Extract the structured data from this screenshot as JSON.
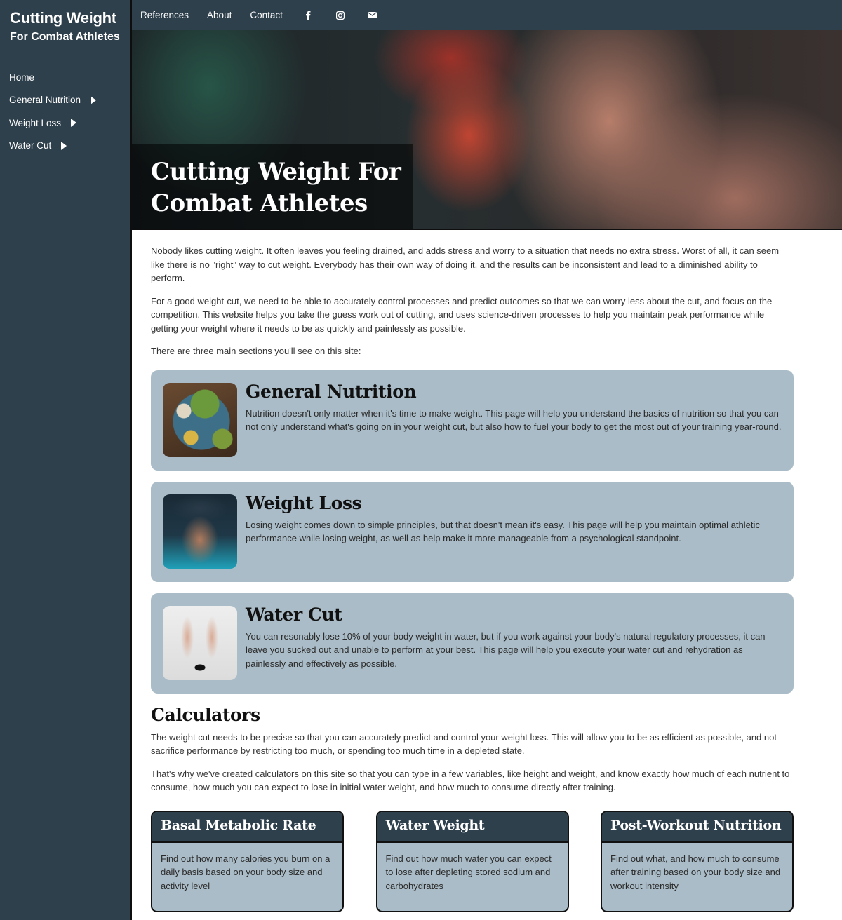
{
  "sidebar": {
    "brand_title": "Cutting Weight",
    "brand_subtitle": "For Combat Athletes",
    "items": [
      {
        "label": "Home",
        "has_submenu": false
      },
      {
        "label": "General Nutrition",
        "has_submenu": true
      },
      {
        "label": "Weight Loss",
        "has_submenu": true
      },
      {
        "label": "Water Cut",
        "has_submenu": true
      }
    ]
  },
  "topbar": {
    "links": [
      "References",
      "About",
      "Contact"
    ],
    "icons": [
      "facebook-icon",
      "instagram-icon",
      "mail-icon"
    ]
  },
  "hero": {
    "title_line1": "Cutting Weight For",
    "title_line2": "Combat Athletes"
  },
  "intro": {
    "p1": "Nobody likes cutting weight. It often leaves you feeling drained, and adds stress and worry to a situation that needs no extra stress. Worst of all, it can seem like there is no \"right\" way to cut weight. Everybody has their own way of doing it, and the results can be inconsistent and lead to a diminished ability to perform.",
    "p2": "For a good weight-cut, we need to be able to accurately control processes and predict outcomes so that we can worry less about the cut, and focus on the competition. This website helps you take the guess work out of cutting, and uses science-driven processes to help you maintain peak performance while getting your weight where it needs to be as quickly and painlessly as possible.",
    "p3": "There are three main sections you'll see on this site:"
  },
  "sections": [
    {
      "title": "General Nutrition",
      "text": "Nutrition doesn't only matter when it's time to make weight. This page will help you understand the basics of nutrition so that you can not only understand what's going on in your weight cut, but also how to fuel your body to get the most out of your training year-round."
    },
    {
      "title": "Weight Loss",
      "text": "Losing weight comes down to simple principles, but that doesn't mean it's easy. This page will help you maintain optimal athletic performance while losing weight, as well as help make it more manageable from a psychological standpoint."
    },
    {
      "title": "Water Cut",
      "text": "You can resonably lose 10% of your body weight in water, but if you work against your body's natural regulatory processes, it can leave you sucked out and unable to perform at your best. This page will help you execute your water cut and rehydration as painlessly and effectively as possible."
    }
  ],
  "calculators": {
    "heading": "Calculators",
    "p1": "The weight cut needs to be precise so that you can accurately predict and control your weight loss. This will allow you to be as efficient as possible, and not sacrifice performance by restricting too much, or spending too much time in a depleted state.",
    "p2": "That's why we've created calculators on this site so that you can type in a few variables, like height and weight, and know exactly how much of each nutrient to consume, how much you can expect to lose in initial water weight, and how much to consume directly after training.",
    "cards": [
      {
        "title": "Basal Metabolic Rate",
        "text": "Find out how many calories you burn on a daily basis based on your body size and activity level"
      },
      {
        "title": "Water Weight",
        "text": "Find out how much water you can expect to lose after depleting stored sodium and carbohydrates"
      },
      {
        "title": "Post-Workout Nutrition",
        "text": "Find out what, and how much to consume after training based on your body size and workout intensity"
      }
    ]
  },
  "colors": {
    "sidebar_bg": "#2f404d",
    "card_bg": "#aabcc7",
    "text": "#333333"
  }
}
